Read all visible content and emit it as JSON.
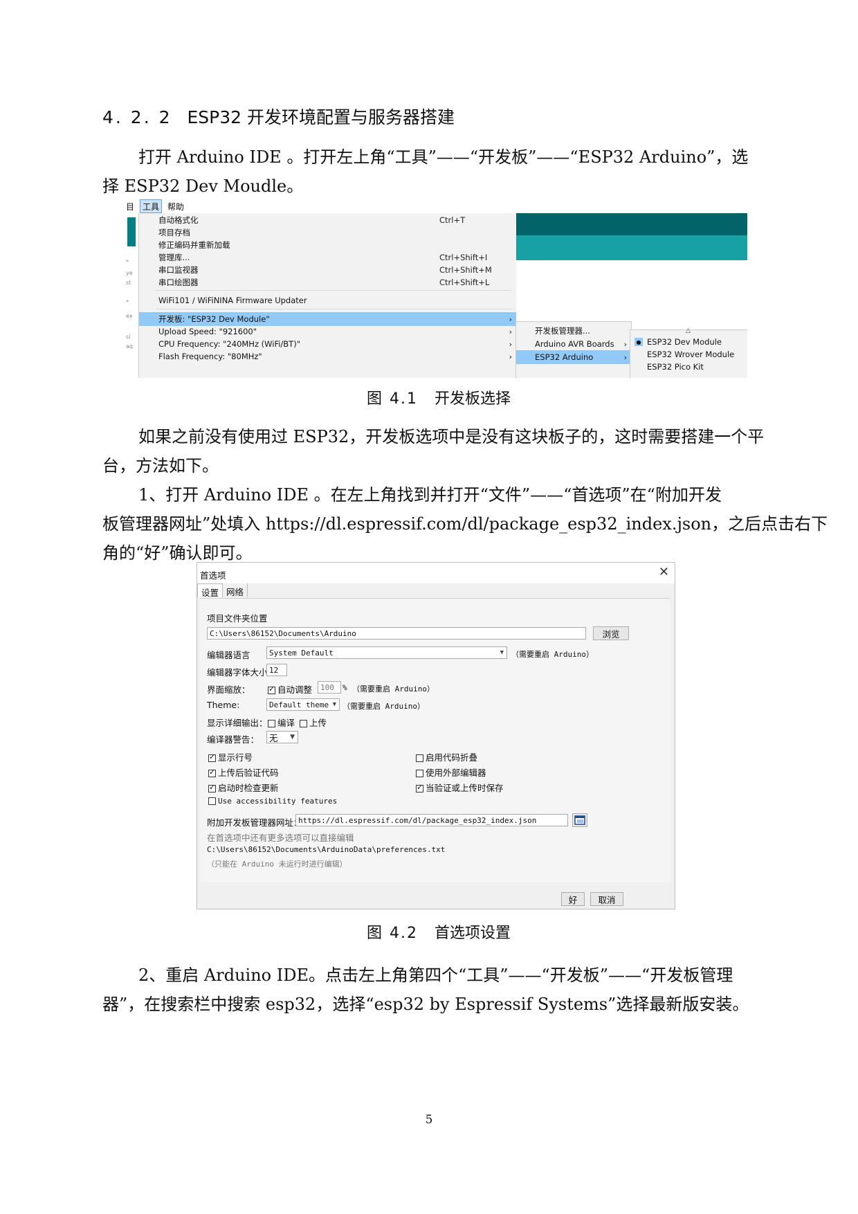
{
  "section": {
    "number": "4. 2. 2",
    "title": "ESP32 开发环境配置与服务器搭建"
  },
  "para1": {
    "line1": "打开 Arduino IDE 。打开左上角“工具”——“开发板”——“ESP32 Arduino”，选",
    "line2": "择 ESP32 Dev Moudle。"
  },
  "figure1": {
    "menubar": [
      "目",
      "工具",
      "帮助"
    ],
    "side_code": [
      "*",
      "ye",
      "st",
      "*",
      "ex",
      "si",
      "aq"
    ],
    "menu_items": [
      {
        "label": "自动格式化",
        "shortcut": "Ctrl+T"
      },
      {
        "label": "项目存档",
        "shortcut": ""
      },
      {
        "label": "修正编码并重新加载",
        "shortcut": ""
      },
      {
        "label": "管理库...",
        "shortcut": "Ctrl+Shift+I"
      },
      {
        "label": "串口监视器",
        "shortcut": "Ctrl+Shift+M"
      },
      {
        "label": "串口绘图器",
        "shortcut": "Ctrl+Shift+L"
      },
      {
        "label": "WiFi101 / WiFiNINA Firmware Updater",
        "shortcut": ""
      },
      {
        "label": "开发板: \"ESP32 Dev Module\"",
        "shortcut": ""
      },
      {
        "label": "Upload Speed: \"921600\"",
        "shortcut": ""
      },
      {
        "label": "CPU Frequency: \"240MHz (WiFi/BT)\"",
        "shortcut": ""
      },
      {
        "label": "Flash Frequency: \"80MHz\"",
        "shortcut": ""
      }
    ],
    "submenu1": [
      "开发板管理器...",
      "Arduino AVR Boards",
      "ESP32 Arduino"
    ],
    "submenu2": [
      "ESP32 Dev Module",
      "ESP32 Wrover Module",
      "ESP32 Pico Kit"
    ],
    "arrow": "›",
    "up_arrow": "△",
    "selected_bullet": "●"
  },
  "caption1": {
    "fig": "图 4.1",
    "text": "开发板选择"
  },
  "para2": {
    "line1": "如果之前没有使用过 ESP32，开发板选项中是没有这块板子的，这时需要搭建一个平",
    "line2": "台，方法如下。"
  },
  "para3": {
    "line1": "1、打开 Arduino IDE 。在左上角找到并打开“文件”——“首选项”在“附加开发",
    "line2": "板管理器网址”处填入 https://dl.espressif.com/dl/package_esp32_index.json，之后点击右下",
    "line3": "角的“好”确认即可。"
  },
  "figure2": {
    "title": "首选项",
    "close": "✕",
    "tabs": [
      "设置",
      "网络"
    ],
    "sketch_location_label": "项目文件夹位置",
    "sketch_location_value": "C:\\Users\\86152\\Documents\\Arduino",
    "browse": "浏览",
    "editor_language_label": "编辑器语言",
    "editor_language_value": "System Default",
    "editor_language_note": "（需要重启 Arduino）",
    "font_size_label": "编辑器字体大小",
    "font_size_value": "12",
    "scale_label": "界面缩放：",
    "scale_auto": "自动调整",
    "scale_value": "100",
    "scale_unit": "%",
    "scale_note": "（需要重启 Arduino）",
    "theme_label": "Theme:",
    "theme_value": "Default theme",
    "theme_note": "（需要重启 Arduino）",
    "verbose_label": "显示详细输出：",
    "verbose_compile": "编译",
    "verbose_upload": "上传",
    "warnings_label": "编译器警告：",
    "warnings_value": "无",
    "checks": [
      {
        "label": "显示行号",
        "on": true
      },
      {
        "label": "启用代码折叠",
        "on": false
      },
      {
        "label": "上传后验证代码",
        "on": true
      },
      {
        "label": "使用外部编辑器",
        "on": false
      },
      {
        "label": "启动时检查更新",
        "on": true
      },
      {
        "label": "当验证或上传时保存",
        "on": true
      },
      {
        "label": "Use accessibility features",
        "on": false
      }
    ],
    "boards_url_label": "附加开发板管理器网址：",
    "boards_url_value": "https://dl.espressif.com/dl/package_esp32_index.json",
    "more_prefs_note": "在首选项中还有更多选项可以直接编辑",
    "prefs_path": "C:\\Users\\86152\\Documents\\ArduinoData\\preferences.txt",
    "edit_note": "（只能在 Arduino 未运行时进行编辑）",
    "ok": "好",
    "cancel": "取消"
  },
  "caption2": {
    "fig": "图 4.2",
    "text": "首选项设置"
  },
  "para4": {
    "line1": "2、重启 Arduino IDE。点击左上角第四个“工具”——“开发板”——“开发板管理",
    "line2": "器”，在搜索栏中搜索 esp32，选择“esp32 by Espressif Systems”选择最新版安装。"
  },
  "page_number": "5"
}
